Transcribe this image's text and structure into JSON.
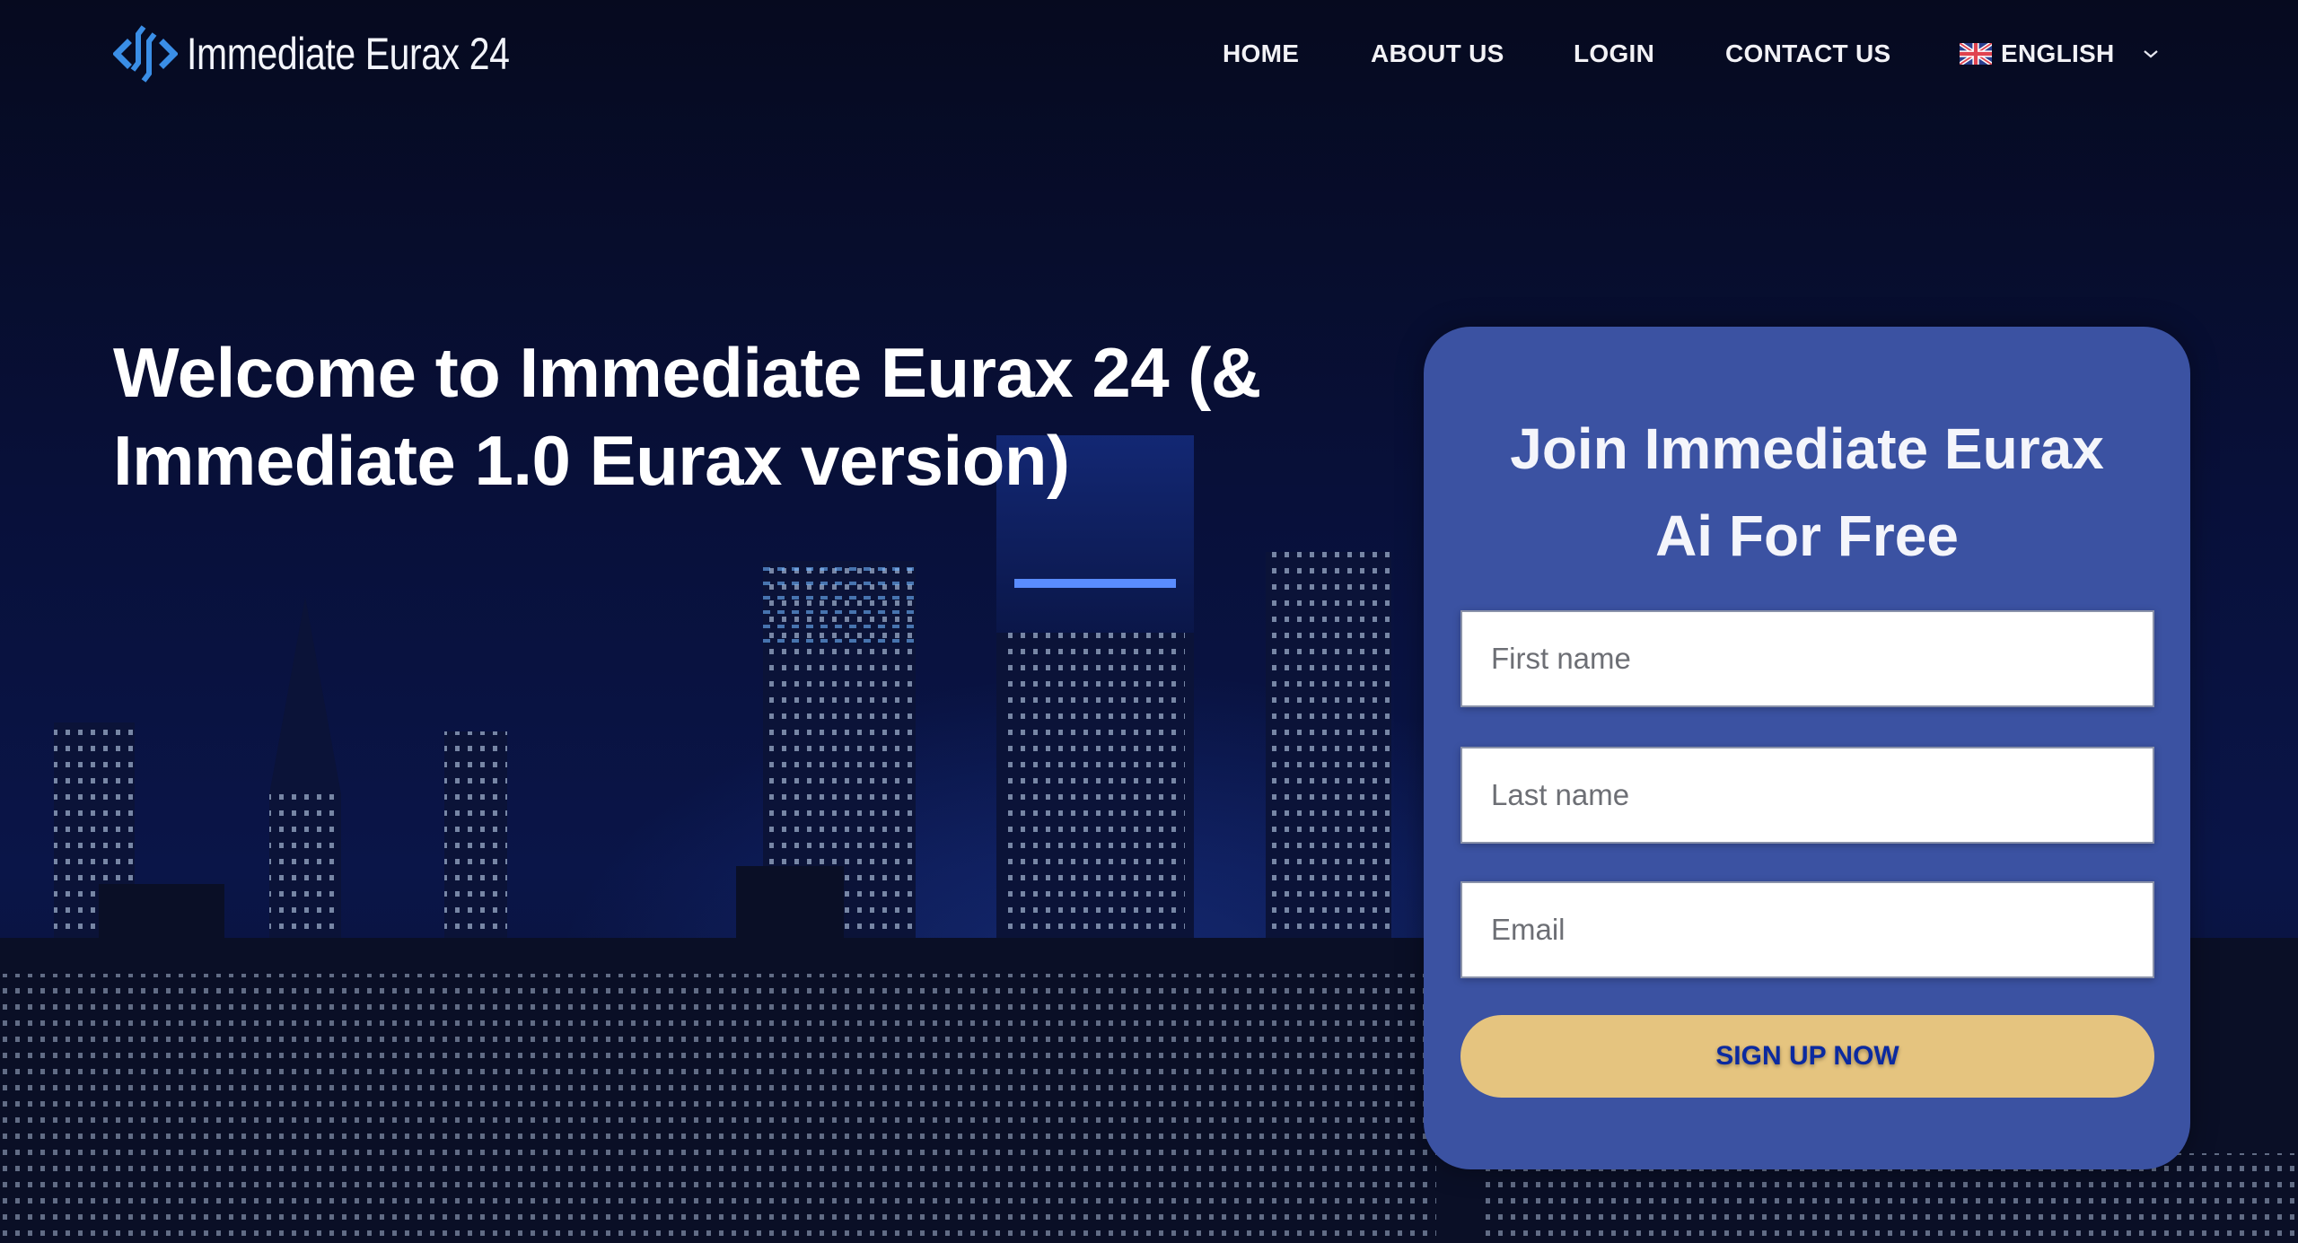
{
  "header": {
    "logo_text": "Immediate Eurax 24",
    "nav": [
      {
        "label": "HOME"
      },
      {
        "label": "ABOUT US"
      },
      {
        "label": "LOGIN"
      },
      {
        "label": "CONTACT US"
      }
    ],
    "language": {
      "label": "ENGLISH",
      "flag": "uk-flag-icon"
    }
  },
  "hero": {
    "title_line1": "Welcome to Immediate Eurax 24 (&",
    "title_line2": "Immediate 1.0 Eurax version)"
  },
  "signup_form": {
    "title_line1": "Join Immediate Eurax",
    "title_line2": "Ai For Free",
    "fields": [
      {
        "placeholder": "First name",
        "value": ""
      },
      {
        "placeholder": "Last name",
        "value": ""
      },
      {
        "placeholder": "Email",
        "value": ""
      }
    ],
    "submit_label": "SIGN UP NOW"
  },
  "colors": {
    "background": "#070c26",
    "card": "#3b52a2",
    "button": "#e5c47f",
    "button_text": "#0b2aa0",
    "logo_accent": "#3a8ee6"
  }
}
